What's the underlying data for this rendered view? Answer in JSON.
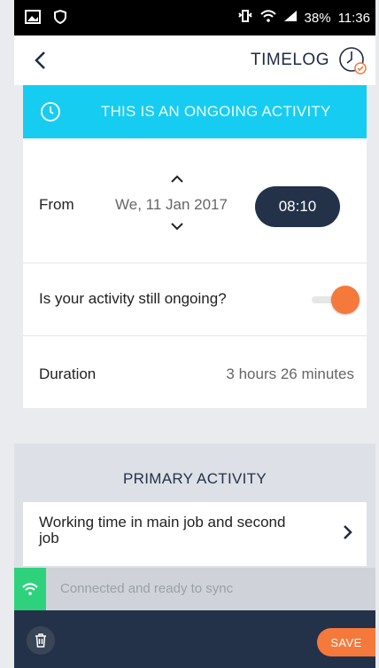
{
  "status_bar": {
    "battery": "38%",
    "time": "11:36"
  },
  "app_bar": {
    "title": "TIMELOG"
  },
  "banner": {
    "text": "THIS IS AN ONGOING ACTIVITY"
  },
  "from": {
    "label": "From",
    "date": "We, 11 Jan 2017",
    "time": "08:10"
  },
  "ongoing": {
    "label": "Is your activity still ongoing?",
    "enabled": true
  },
  "duration": {
    "label": "Duration",
    "value": "3 hours 26 minutes"
  },
  "primary_activity": {
    "heading": "PRIMARY ACTIVITY",
    "item_title": "Working time in main job and second job"
  },
  "sync": {
    "text": "Connected and ready to sync"
  },
  "actions": {
    "save_label": "SAVE"
  },
  "colors": {
    "accent": "#17ccf1",
    "orange": "#f5793b",
    "navy": "#243249",
    "green": "#2fd27c"
  },
  "icons": [
    "image-icon",
    "shield-icon",
    "vibrate-icon",
    "wifi-icon",
    "signal-icon",
    "back-icon",
    "clock-icon",
    "chevron-up-icon",
    "chevron-down-icon",
    "chevron-right-icon",
    "trash-icon"
  ]
}
